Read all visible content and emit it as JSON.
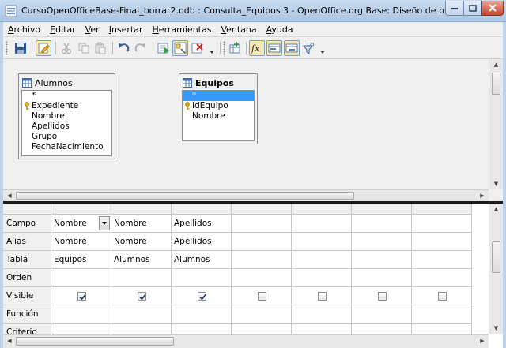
{
  "window": {
    "title": "CursoOpenOfficeBase-Final_borrar2.odb : Consulta_Equipos 3 - OpenOffice.org Base: Diseño de busqueda"
  },
  "menu": [
    {
      "accel": "A",
      "rest": "rchivo"
    },
    {
      "accel": "E",
      "rest": "ditar"
    },
    {
      "accel": "V",
      "rest": "er"
    },
    {
      "accel": "I",
      "rest": "nsertar"
    },
    {
      "accel": "H",
      "rest": "erramientas"
    },
    {
      "accel": "V",
      "rest": "entana"
    },
    {
      "accel": "A",
      "rest": "yuda"
    }
  ],
  "tables": [
    {
      "name": "Alumnos",
      "fields": [
        "*",
        "Expediente",
        "Nombre",
        "Apellidos",
        "Grupo",
        "FechaNacimiento"
      ],
      "key_field": "Expediente",
      "selected_field": ""
    },
    {
      "name": "Equipos",
      "fields": [
        "*",
        "IdEquipo",
        "Nombre"
      ],
      "key_field": "IdEquipo",
      "selected_field": "*"
    }
  ],
  "grid": {
    "row_labels": [
      "Campo",
      "Alias",
      "Tabla",
      "Orden",
      "Visible",
      "Función",
      "Criterio"
    ],
    "columns": [
      {
        "campo": "Nombre",
        "alias": "Nombre",
        "tabla": "Equipos",
        "visible": true
      },
      {
        "campo": "Nombre",
        "alias": "Nombre",
        "tabla": "Alumnos",
        "visible": true
      },
      {
        "campo": "Apellidos",
        "alias": "Apellidos",
        "tabla": "Alumnos",
        "visible": true
      },
      {
        "campo": "",
        "alias": "",
        "tabla": "",
        "visible": false
      },
      {
        "campo": "",
        "alias": "",
        "tabla": "",
        "visible": false
      },
      {
        "campo": "",
        "alias": "",
        "tabla": "",
        "visible": false
      },
      {
        "campo": "",
        "alias": "",
        "tabla": "",
        "visible": false
      }
    ]
  },
  "colors": {
    "accent": "#3399ff",
    "splitter": "#1a1a1a",
    "key": "#d9a400"
  }
}
